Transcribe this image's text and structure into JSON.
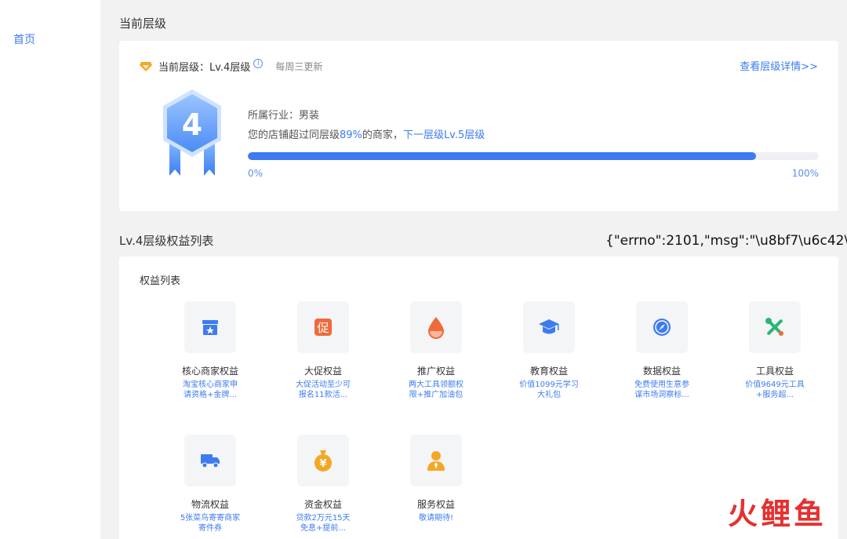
{
  "sidebar": {
    "home": "首页"
  },
  "section1": {
    "title": "当前层级"
  },
  "level": {
    "label": "当前层级：Lv.4层级",
    "info_symbol": "i",
    "weekly": "每周三更新",
    "detail_link": "查看层级详情>>",
    "badge_number": "4",
    "industry": "所属行业：男装",
    "exceed_prefix": "您的店铺超过同层级",
    "exceed_percent": "89%",
    "exceed_suffix": "的商家，",
    "next_level": "下一层级Lv.5层级",
    "progress": 0.89,
    "progress_min": "0%",
    "progress_max": "100%"
  },
  "section2": {
    "title": "Lv.4层级权益列表"
  },
  "overlay_text": "{\"errno\":2101,\"msg\":\"\\u8bf7\\u6c42\\u8",
  "benefits_title": "权益列表",
  "benefits": [
    {
      "name": "核心商家权益",
      "desc1": "淘宝核心商家申",
      "desc2": "请资格+金牌...",
      "icon": "store-icon"
    },
    {
      "name": "大促权益",
      "desc1": "大促活动至少可",
      "desc2": "报名11款活...",
      "icon": "promo-icon",
      "glyph": "促"
    },
    {
      "name": "推广权益",
      "desc1": "两大工具领额权",
      "desc2": "限+推广加油包",
      "icon": "drop-icon"
    },
    {
      "name": "教育权益",
      "desc1": "价值1099元学习",
      "desc2": "大礼包",
      "icon": "graduation-cap-icon"
    },
    {
      "name": "数据权益",
      "desc1": "免费使用生意参",
      "desc2": "谋市场洞察标...",
      "icon": "compass-icon"
    },
    {
      "name": "工具权益",
      "desc1": "价值9649元工具",
      "desc2": "+服务超...",
      "icon": "tools-icon"
    },
    {
      "name": "物流权益",
      "desc1": "5张菜鸟寄寄商家",
      "desc2": "寄件券",
      "icon": "truck-icon"
    },
    {
      "name": "资金权益",
      "desc1": "贷款2万元15天",
      "desc2": "免息+提前...",
      "icon": "money-bag-icon"
    },
    {
      "name": "服务权益",
      "desc1": "敬请期待!",
      "desc2": "",
      "icon": "service-person-icon"
    }
  ],
  "watermark": {
    "c1": "火",
    "c2": "鲤",
    "c3": "鱼"
  },
  "colors": {
    "accent": "#3d7bf0",
    "orange": "#f06a3a",
    "gold": "#f5a623",
    "green": "#2bb673"
  }
}
